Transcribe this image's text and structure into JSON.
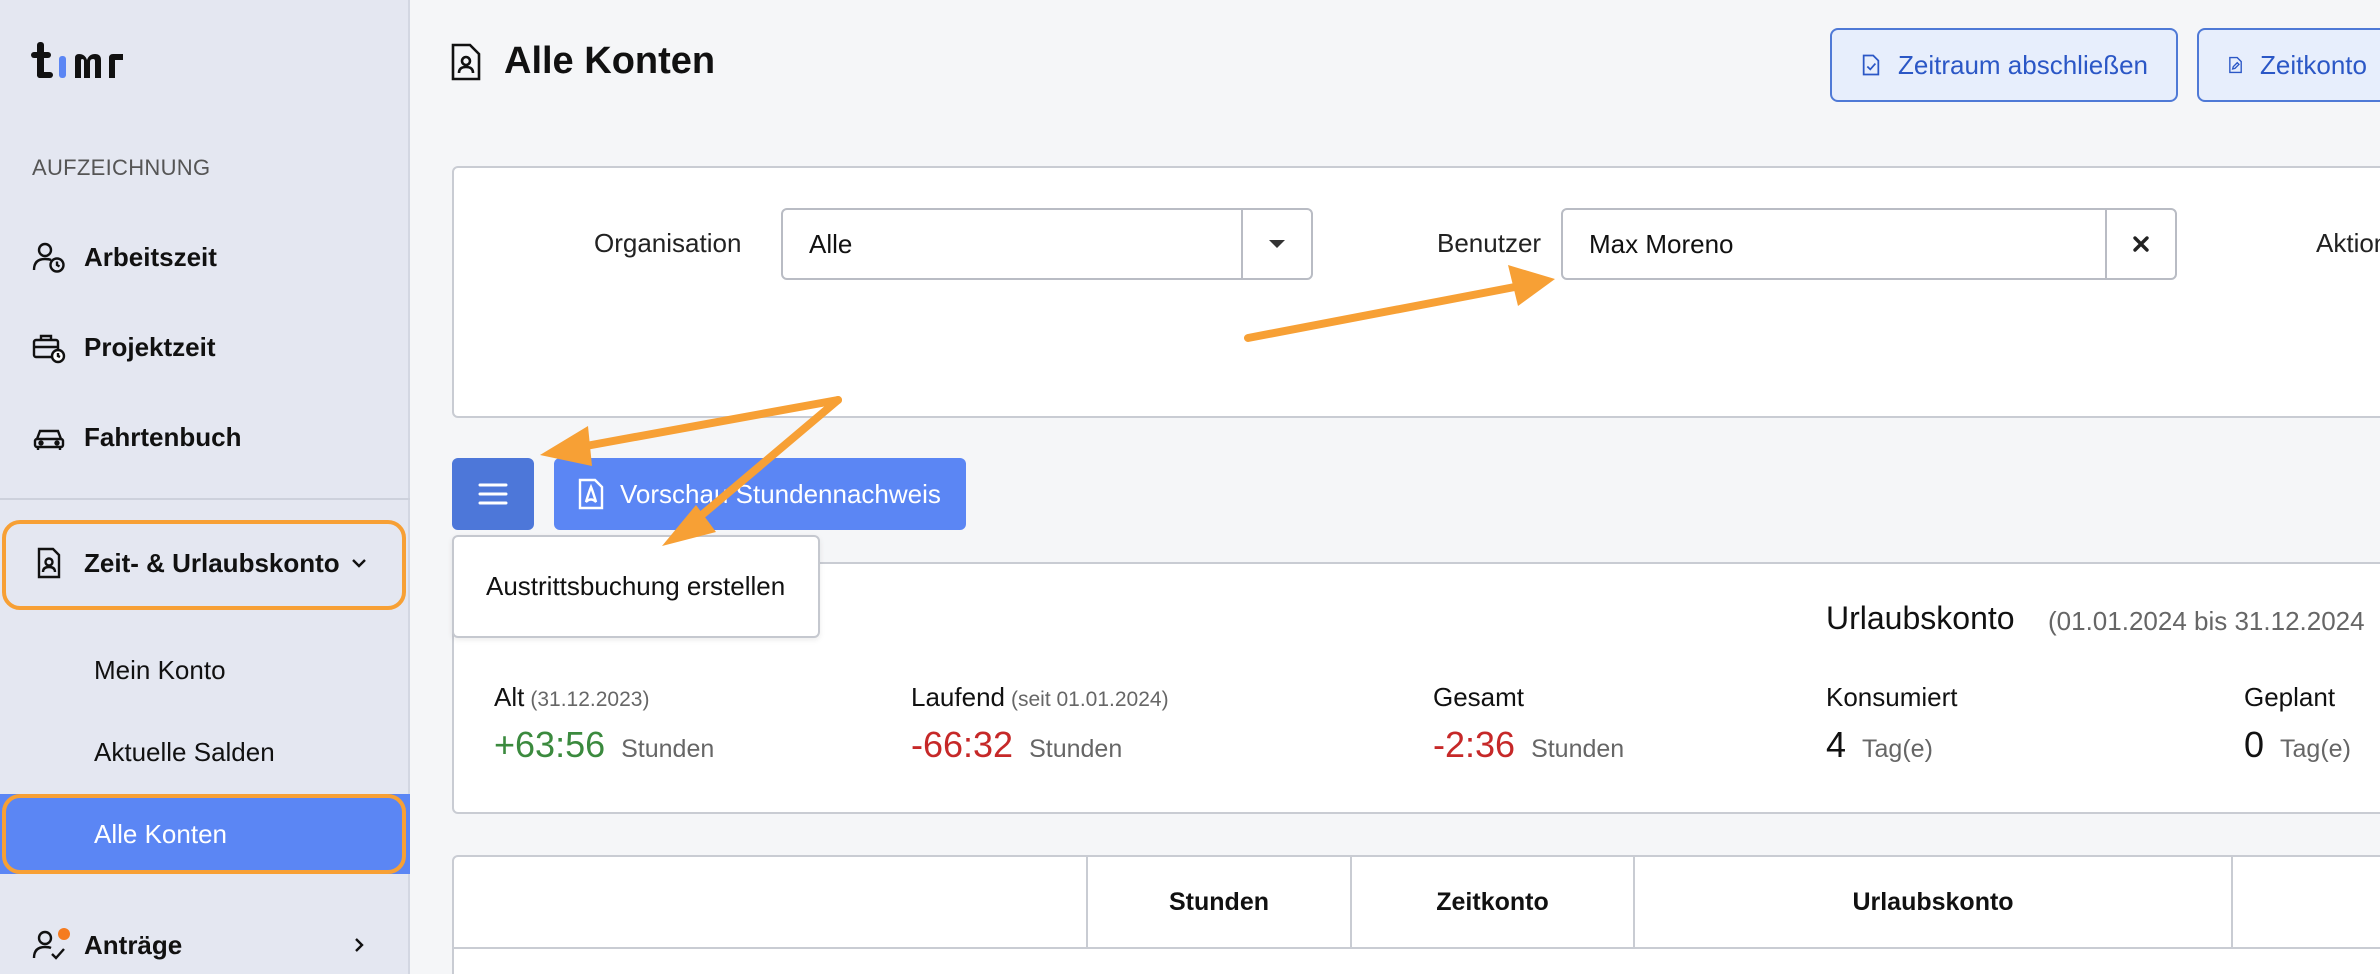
{
  "sidebar": {
    "section": "AUFZEICHNUNG",
    "items": [
      {
        "label": "Arbeitszeit",
        "icon": "user-clock-icon"
      },
      {
        "label": "Projektzeit",
        "icon": "briefcase-clock-icon"
      },
      {
        "label": "Fahrtenbuch",
        "icon": "car-icon"
      }
    ],
    "account_group": {
      "label": "Zeit- & Urlaubskonto",
      "icon": "document-user-icon"
    },
    "sub_items": [
      "Mein Konto",
      "Aktuelle Salden",
      "Alle Konten"
    ],
    "requests": {
      "label": "Anträge",
      "icon": "user-check-icon"
    }
  },
  "header": {
    "title": "Alle Konten",
    "btn_close_period": "Zeitraum abschließen",
    "btn_time_account": "Zeitkonto"
  },
  "filters": {
    "org_label": "Organisation",
    "org_value": "Alle",
    "user_label": "Benutzer",
    "user_value": "Max Moreno",
    "actions_label": "Aktion"
  },
  "actions": {
    "preview_label": "Vorschau Stundennachweis",
    "dropdown_item": "Austrittsbuchung erstellen"
  },
  "balance": {
    "urlaub_title": "Urlaubskonto",
    "urlaub_range": "(01.01.2024 bis 31.12.2024",
    "alt": {
      "label": "Alt",
      "note": "(31.12.2023)",
      "value": "+63:56",
      "unit": "Stunden"
    },
    "laufend": {
      "label": "Laufend",
      "note": "(seit 01.01.2024)",
      "value": "-66:32",
      "unit": "Stunden"
    },
    "gesamt": {
      "label": "Gesamt",
      "value": "-2:36",
      "unit": "Stunden"
    },
    "konsumiert": {
      "label": "Konsumiert",
      "value": "4",
      "unit": "Tag(e)"
    },
    "geplant": {
      "label": "Geplant",
      "value": "0",
      "unit": "Tag(e)"
    }
  },
  "table": {
    "headers": [
      "Stunden",
      "Zeitkonto",
      "Urlaubskonto"
    ]
  },
  "colors": {
    "accent": "#5b86f4",
    "highlight": "#f7a035",
    "positive": "#3b8a3e",
    "negative": "#c62828"
  }
}
